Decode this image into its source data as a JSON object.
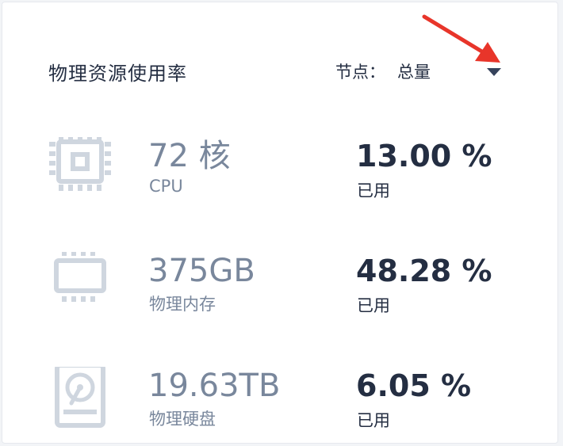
{
  "card": {
    "title": "物理资源使用率",
    "node_selector": {
      "label": "节点：",
      "value": "总量"
    }
  },
  "resources": [
    {
      "icon": "cpu-chip-icon",
      "amount": "72 核",
      "name": "CPU",
      "usage": "13.00 %",
      "usage_label": "已用"
    },
    {
      "icon": "memory-module-icon",
      "amount": "375GB",
      "name": "物理内存",
      "usage": "48.28 %",
      "usage_label": "已用"
    },
    {
      "icon": "hard-disk-icon",
      "amount": "19.63TB",
      "name": "物理硬盘",
      "usage": "6.05 %",
      "usage_label": "已用"
    }
  ],
  "colors": {
    "title_text": "#242e42",
    "muted_text": "#79879c",
    "icon_gray": "#cfd6df",
    "caret": "#36435c",
    "annotation_arrow": "#e8352a"
  }
}
